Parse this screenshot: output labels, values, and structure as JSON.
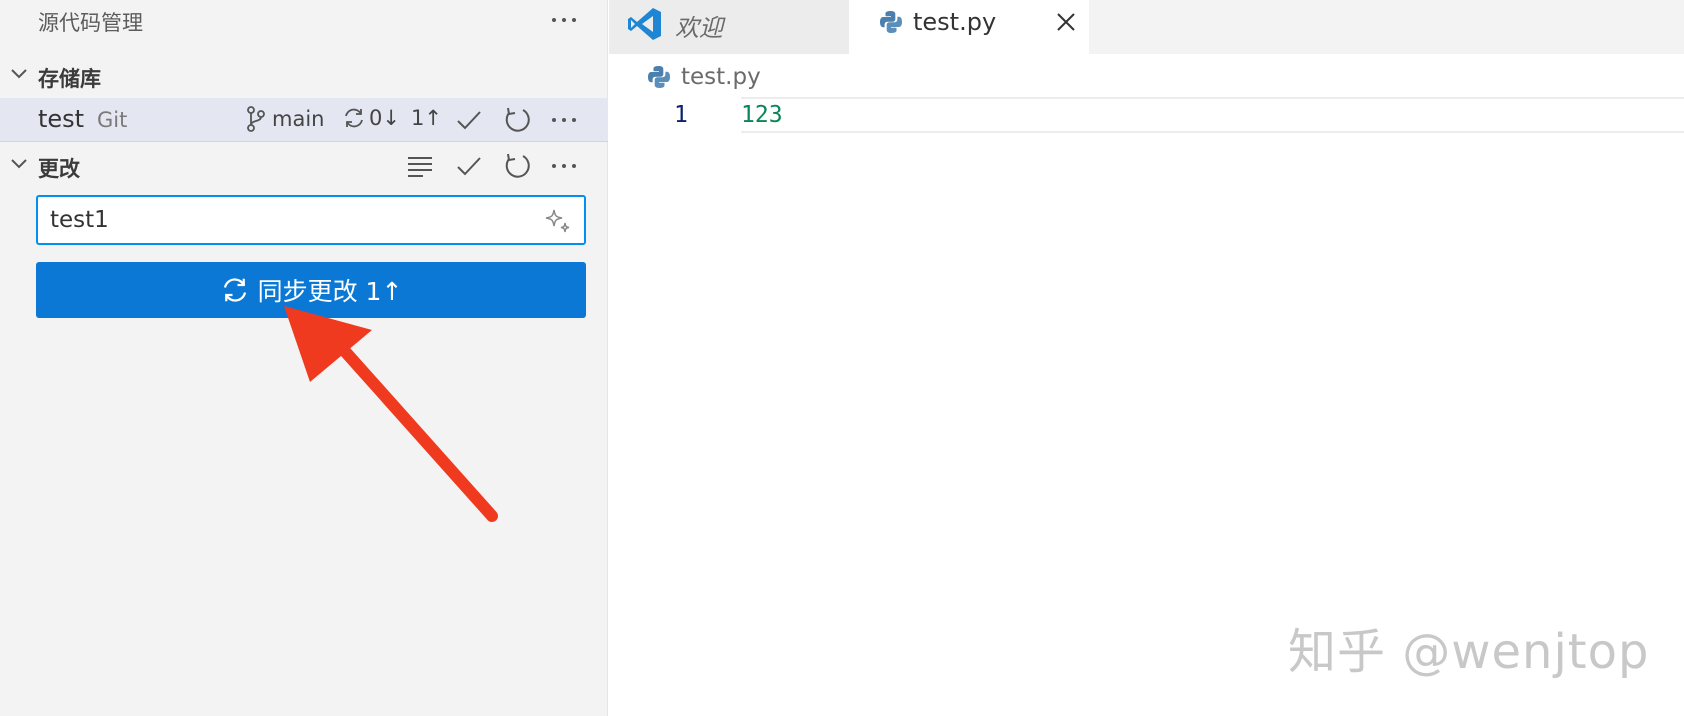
{
  "sidebar": {
    "title": "源代码管理",
    "repositories": {
      "title": "存储库",
      "repo": {
        "name": "test",
        "kind": "Git",
        "branch": "main",
        "incoming": "0↓",
        "outgoing": "1↑"
      }
    },
    "changes": {
      "title": "更改",
      "commit_message": "test1",
      "sync_button_label": "同步更改 1↑"
    }
  },
  "tabs": [
    {
      "label": "欢迎",
      "icon": "vscode-logo-icon",
      "active": false
    },
    {
      "label": "test.py",
      "icon": "python-file-icon",
      "active": true
    }
  ],
  "editor": {
    "breadcrumb": "test.py",
    "lines": [
      {
        "number": "1",
        "text": "123"
      }
    ]
  },
  "watermark": "知乎 @wenjtop",
  "colors": {
    "accent": "#0a78d4",
    "focus_border": "#0090f1",
    "annotation_arrow": "#f03a1f",
    "number_literal": "#098658"
  }
}
